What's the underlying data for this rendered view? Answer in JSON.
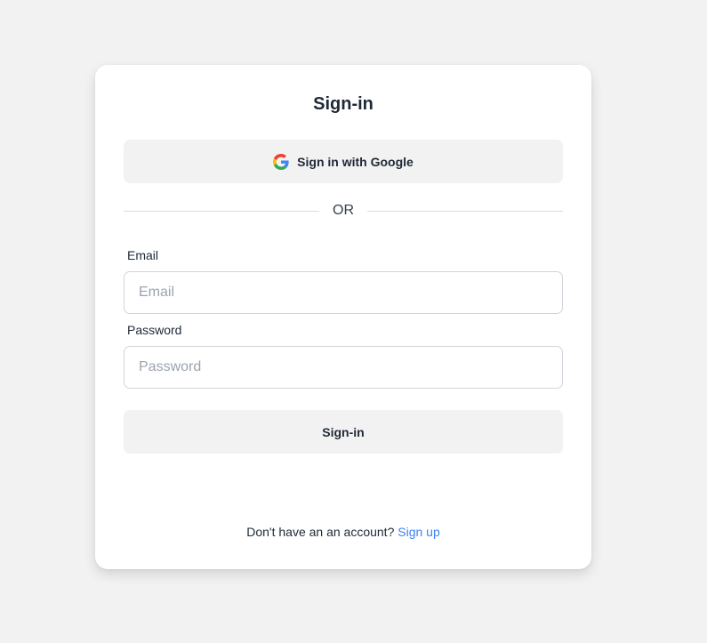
{
  "signin": {
    "title": "Sign-in",
    "google_button_label": "Sign in with Google",
    "divider_text": "OR",
    "email": {
      "label": "Email",
      "value": "",
      "placeholder": "Email"
    },
    "password": {
      "label": "Password",
      "value": "",
      "placeholder": "Password"
    },
    "submit_label": "Sign-in",
    "footer": {
      "prompt": "Don't have an an account?",
      "link_label": "Sign up"
    }
  },
  "colors": {
    "background": "#f2f2f2",
    "card": "#ffffff",
    "button_bg": "#f2f2f2",
    "link": "#3b82f6",
    "text": "#1f2937"
  },
  "icons": {
    "google": "google-icon"
  }
}
